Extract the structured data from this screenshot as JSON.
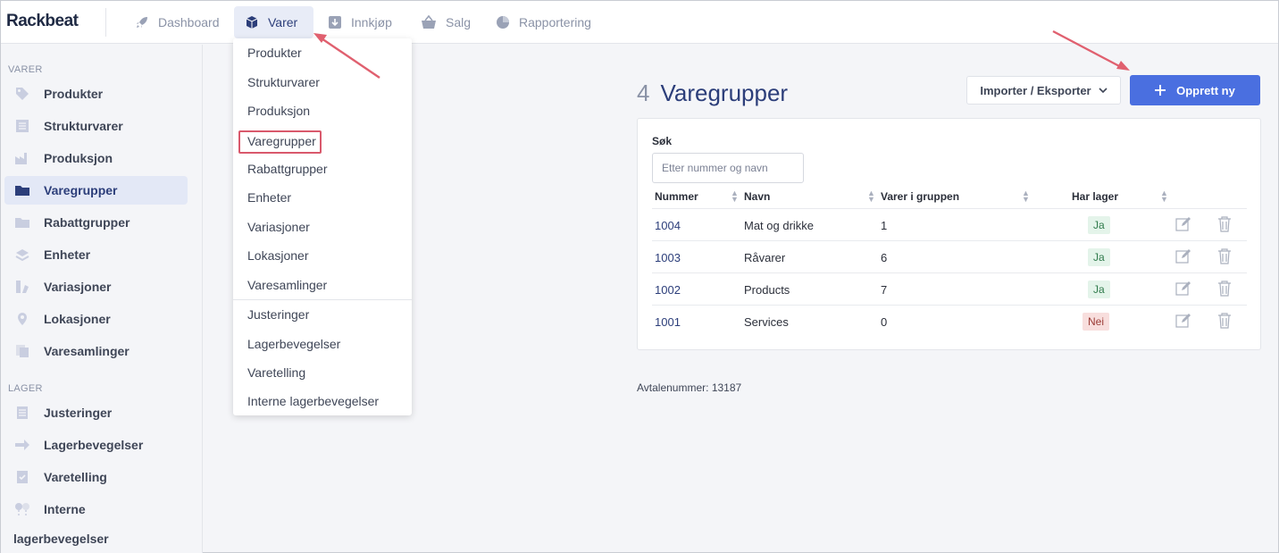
{
  "app": {
    "logo": "Rackbeat"
  },
  "topnav": {
    "items": [
      {
        "label": "Dashboard",
        "icon": "rocket-icon"
      },
      {
        "label": "Varer",
        "icon": "cube-icon"
      },
      {
        "label": "Innkjøp",
        "icon": "download-box-icon"
      },
      {
        "label": "Salg",
        "icon": "basket-icon"
      },
      {
        "label": "Rapportering",
        "icon": "pie-chart-icon"
      }
    ],
    "active": "Varer"
  },
  "sidebar": {
    "section1": "VARER",
    "items1": [
      {
        "label": "Produkter",
        "icon": "tag-icon"
      },
      {
        "label": "Strukturvarer",
        "icon": "list-doc-icon"
      },
      {
        "label": "Produksjon",
        "icon": "factory-icon"
      },
      {
        "label": "Varegrupper",
        "icon": "folder-icon"
      },
      {
        "label": "Rabattgrupper",
        "icon": "folder-icon"
      },
      {
        "label": "Enheter",
        "icon": "layers-icon"
      },
      {
        "label": "Variasjoner",
        "icon": "variants-icon"
      },
      {
        "label": "Lokasjoner",
        "icon": "map-pin-icon"
      },
      {
        "label": "Varesamlinger",
        "icon": "copy-icon"
      }
    ],
    "section2": "LAGER",
    "items2": [
      {
        "label": "Justeringer",
        "icon": "clipboard-icon"
      },
      {
        "label": "Lagerbevegelser",
        "icon": "arrow-right-icon"
      },
      {
        "label": "Varetelling",
        "icon": "checklist-icon"
      },
      {
        "label": "Interne",
        "icon": "pins-icon"
      }
    ],
    "items2_wrap": "lagerbevegelser",
    "active": "Varegrupper"
  },
  "dropdown": {
    "items": [
      "Produkter",
      "Strukturvarer",
      "Produksjon",
      "Varegrupper",
      "Rabattgrupper",
      "Enheter",
      "Variasjoner",
      "Lokasjoner",
      "Varesamlinger",
      "Justeringer",
      "Lagerbevegelser",
      "Varetelling",
      "Interne lagerbevegelser"
    ],
    "highlighted": "Varegrupper"
  },
  "main": {
    "count": "4",
    "title": "Varegrupper",
    "import_label": "Importer / Eksporter",
    "create_label": "Opprett ny",
    "search_label": "Søk",
    "search_placeholder": "Etter nummer og navn",
    "columns": [
      "Nummer",
      "Navn",
      "Varer i gruppen",
      "Har lager"
    ],
    "rows": [
      {
        "number": "1004",
        "name": "Mat og drikke",
        "count": "1",
        "stock": "Ja",
        "has_stock": true
      },
      {
        "number": "1003",
        "name": "Råvarer",
        "count": "6",
        "stock": "Ja",
        "has_stock": true
      },
      {
        "number": "1002",
        "name": "Products",
        "count": "7",
        "stock": "Ja",
        "has_stock": true
      },
      {
        "number": "1001",
        "name": "Services",
        "count": "0",
        "stock": "Nei",
        "has_stock": false
      }
    ],
    "footer": "Avtalenummer: 13187"
  },
  "colors": {
    "accent": "#4a6fe0",
    "nav_active_bg": "#e8ecf7",
    "highlight": "#d9596c"
  }
}
